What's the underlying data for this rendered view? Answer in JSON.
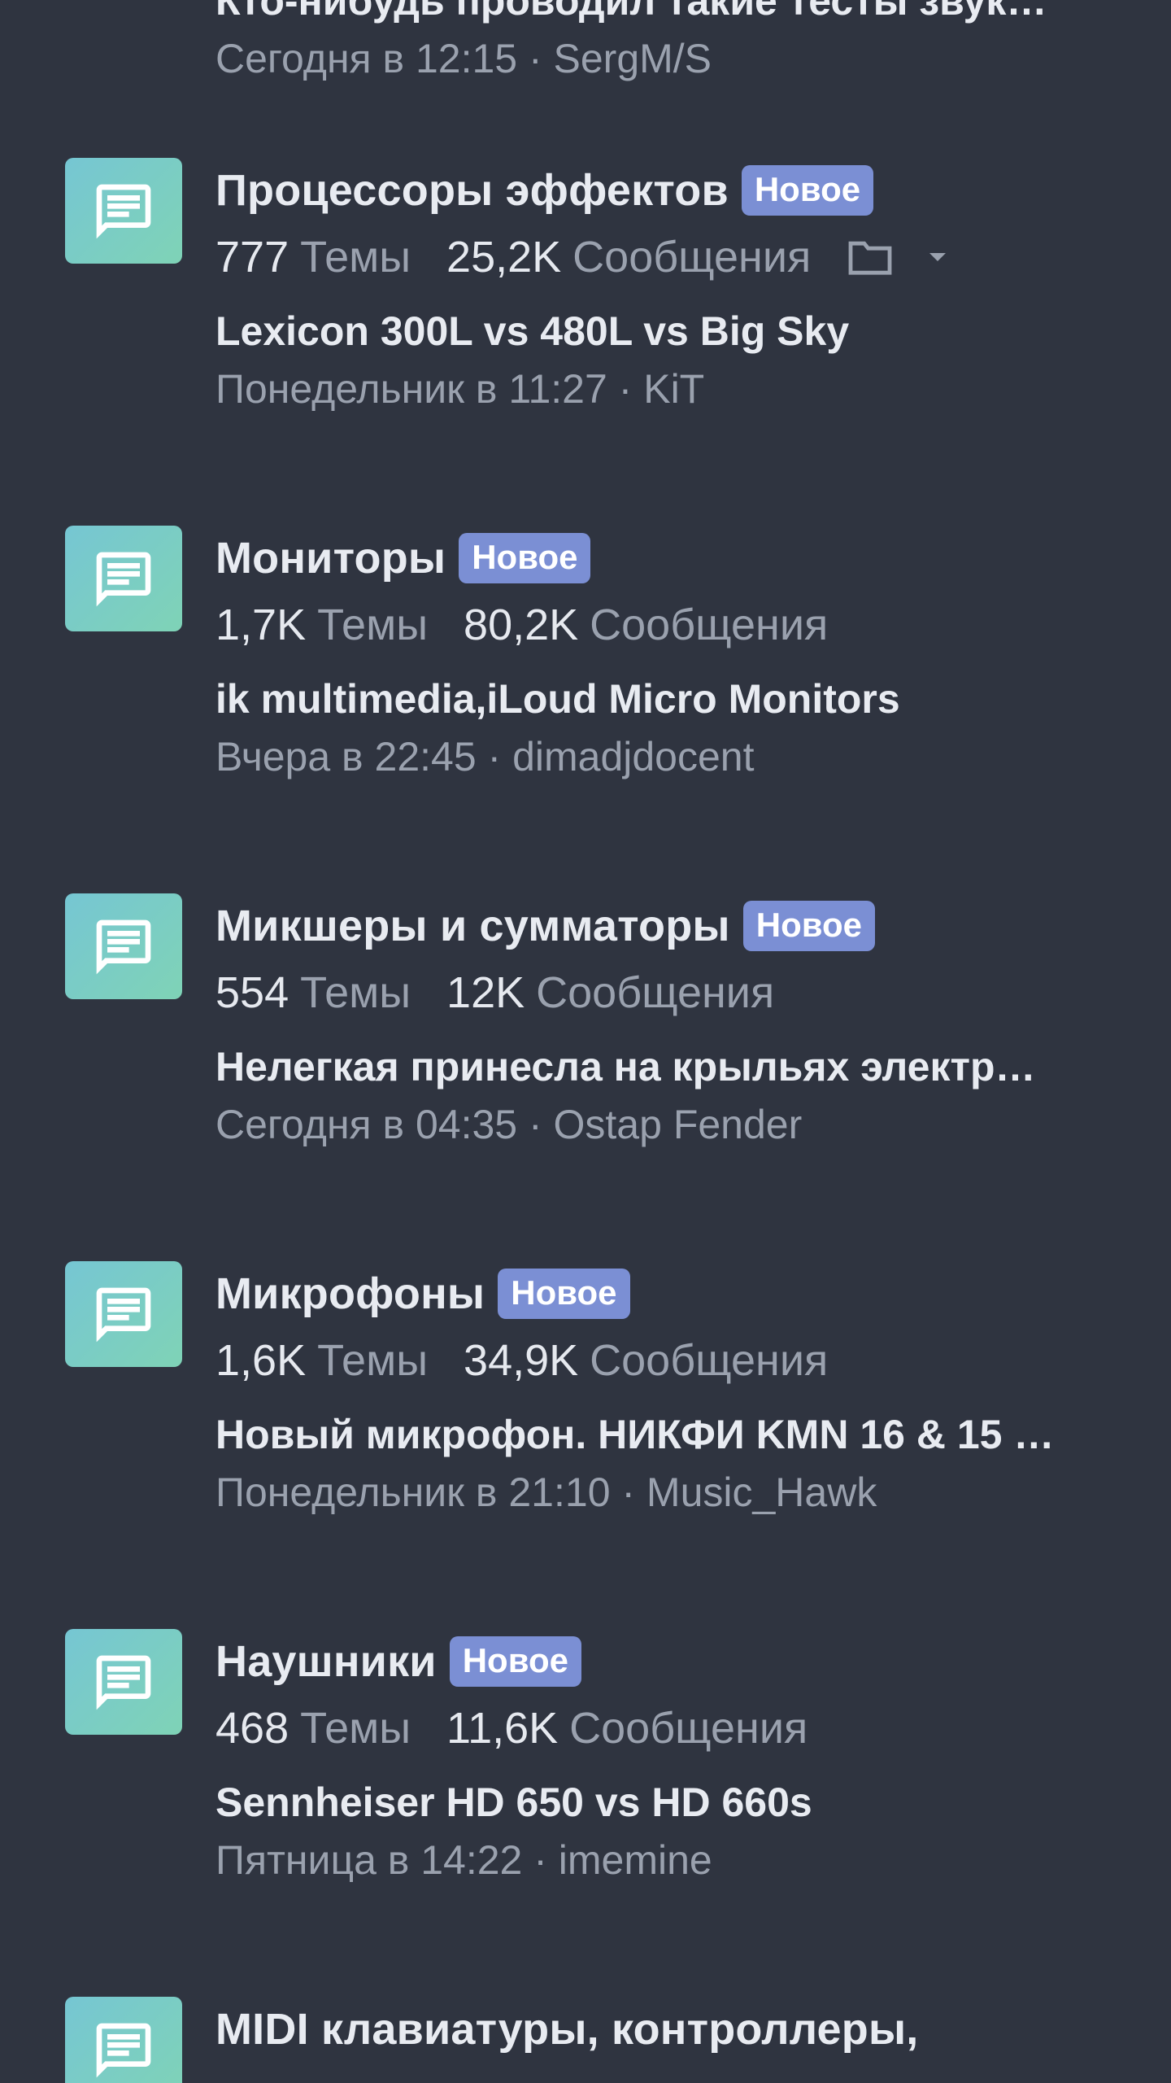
{
  "top_partial": {
    "last_title": "Кто-нибудь проводил такие тесты звук…",
    "last_meta": "Сегодня в 12:15 · SergM/S"
  },
  "badge_label": "Новое",
  "stats_labels": {
    "threads": "Темы",
    "messages": "Сообщения"
  },
  "forums": [
    {
      "title": "Процессоры эффектов",
      "threads": "777",
      "messages": "25,2K",
      "last_title": "Lexicon 300L vs 480L vs Big Sky",
      "last_meta": "Понедельник в 11:27 · KiT",
      "has_subforums": true
    },
    {
      "title": "Мониторы",
      "threads": "1,7K",
      "messages": "80,2K",
      "last_title": "ik multimedia,iLoud Micro Monitors",
      "last_meta": "Вчера в 22:45 · dimadjdocent"
    },
    {
      "title": "Микшеры и сумматоры",
      "threads": "554",
      "messages": "12K",
      "last_title": "Нелегкая принесла на крыльях электр…",
      "last_meta": "Сегодня в 04:35 · Ostap Fender"
    },
    {
      "title": "Микрофоны",
      "threads": "1,6K",
      "messages": "34,9K",
      "last_title": "Новый микрофон. НИКФИ KMN 16 & 15 …",
      "last_meta": "Понедельник в 21:10 · Music_Hawk"
    },
    {
      "title": "Наушники",
      "threads": "468",
      "messages": "11,6K",
      "last_title": "Sennheiser HD 650 vs HD 660s",
      "last_meta": "Пятница в 14:22 · imemine"
    },
    {
      "title": "MIDI клавиатуры, контроллеры,"
    }
  ],
  "colors": {
    "background": "#2f3440",
    "badge": "#7b8fd4",
    "icon_gradient_start": "#76c6d3",
    "icon_gradient_end": "#7fd3b6",
    "muted_text": "#9aa1ae"
  },
  "icons": {
    "forum": "chat-bubble-icon",
    "subforums": "folder-icon",
    "expand": "caret-down-icon"
  }
}
